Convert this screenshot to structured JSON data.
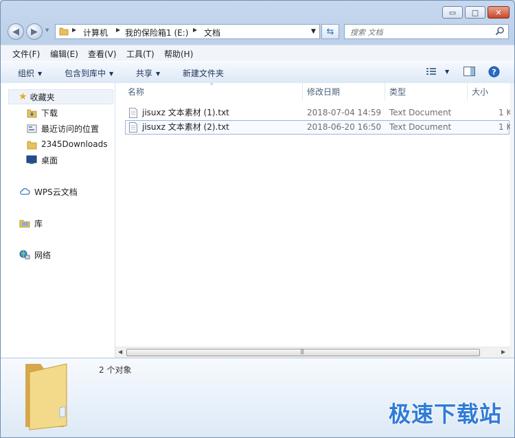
{
  "title_buttons": {
    "minimize": "▭",
    "maximize": "□",
    "close": "✕"
  },
  "address": {
    "crumbs": [
      "计算机",
      "我的保险箱1 (E:)",
      "文档"
    ]
  },
  "search": {
    "placeholder": "搜索 文档"
  },
  "menu": [
    "文件(F)",
    "编辑(E)",
    "查看(V)",
    "工具(T)",
    "帮助(H)"
  ],
  "toolbar": {
    "organize": "组织",
    "include_in_library": "包含到库中",
    "share": "共享",
    "new_folder": "新建文件夹"
  },
  "sidebar": {
    "favorites": "收藏夹",
    "favorites_items": [
      "下载",
      "最近访问的位置",
      "2345Downloads",
      "桌面"
    ],
    "wps": "WPS云文档",
    "libraries": "库",
    "network": "网络"
  },
  "columns": {
    "name": "名称",
    "modified": "修改日期",
    "type": "类型",
    "size": "大小"
  },
  "files": [
    {
      "name": "jisuxz 文本素材 (1).txt",
      "modified": "2018-07-04 14:59",
      "type": "Text Document",
      "size": "1 K"
    },
    {
      "name": "jisuxz 文本素材 (2).txt",
      "modified": "2018-06-20 16:50",
      "type": "Text Document",
      "size": "1 K"
    }
  ],
  "details": {
    "count": "2 个对象"
  },
  "watermark": "极速下载站",
  "colors": {
    "accent": "#2f7bd8",
    "folder": "#e8c15a"
  }
}
